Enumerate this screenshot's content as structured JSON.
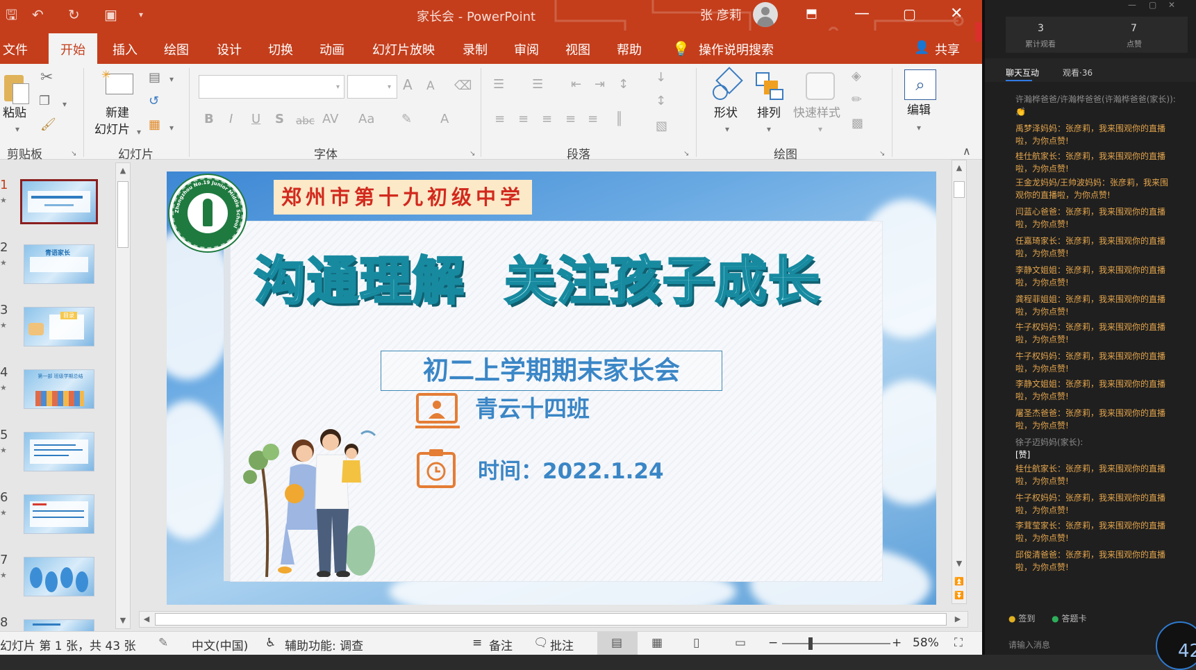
{
  "title_bar": {
    "document_title": "家长会 - PowerPoint",
    "user_name": "张 彦莉",
    "icons": [
      "save-icon",
      "undo-icon",
      "redo-icon",
      "present-from-start-icon",
      "customize-qat-icon",
      "ribbon-display-icon",
      "minimize-icon",
      "maximize-icon",
      "close-icon"
    ]
  },
  "menu": {
    "items": [
      "文件",
      "开始",
      "插入",
      "绘图",
      "设计",
      "切换",
      "动画",
      "幻灯片放映",
      "录制",
      "审阅",
      "视图",
      "帮助"
    ],
    "active": "开始",
    "tell_me": "操作说明搜索",
    "share": "共享"
  },
  "ribbon": {
    "groups": {
      "clipboard": "剪贴板",
      "slides": "幻灯片",
      "font": "字体",
      "paragraph": "段落",
      "drawing": "绘图"
    },
    "paste": "粘贴",
    "new_slide_1": "新建",
    "new_slide_2": "幻灯片",
    "shape": "形状",
    "arrange": "排列",
    "quick_styles": "快速样式",
    "edit": "编辑",
    "font_buttons": [
      "B",
      "I",
      "U",
      "S",
      "abc",
      "AV",
      "Aa",
      "A"
    ],
    "grow_font": "A",
    "shrink_font": "A"
  },
  "thumbnails": {
    "numbers": [
      "1",
      "2",
      "3",
      "4",
      "5",
      "6",
      "7",
      "8"
    ],
    "active_index": 0,
    "thumb2_title": "青语家长",
    "thumb3_title": "目录",
    "thumb4_title": "第一部 班级学期总结"
  },
  "slide": {
    "school_name": "郑州市第十九初级中学",
    "logo_text": "Zhengzhou No.19 Junior Middle School",
    "logo_cn": "郑州市第十九初级中学",
    "headline_left": "沟通理解",
    "headline_right": "关注孩子成长",
    "subtitle": "初二上学期期末家长会",
    "class_name": "青云十四班",
    "date_text": "时间：2022.1.24"
  },
  "status_bar": {
    "slide_info": "幻灯片 第 1 张，共 43 张",
    "language": "中文(中国)",
    "accessibility": "辅助功能: 调查",
    "notes": "备注",
    "comments": "批注",
    "zoom": "58%"
  },
  "live_panel": {
    "views_total": "3",
    "views_label": "累计观看",
    "likes": "7",
    "likes_label": "点赞",
    "tab_chat": "聊天互动",
    "tab_viewers": "观看·36",
    "messages": [
      {
        "text": "许瀚桦爸爸/许瀚桦爸爸(许瀚桦爸爸(家长)):",
        "gray": true,
        "extra": "👏"
      },
      {
        "text": "禹梦泽妈妈：张彦莉，我来围观你的直播啦，为你点赞!"
      },
      {
        "text": "桂仕航家长：张彦莉，我来围观你的直播啦，为你点赞!"
      },
      {
        "text": "王金龙妈妈/王帅波妈妈：张彦莉，我来围观你的直播啦，为你点赞!"
      },
      {
        "text": "闫蓝心爸爸：张彦莉，我来围观你的直播啦，为你点赞!"
      },
      {
        "text": "任嘉琦家长：张彦莉，我来围观你的直播啦，为你点赞!"
      },
      {
        "text": "李静文姐姐：张彦莉，我来围观你的直播啦，为你点赞!"
      },
      {
        "text": "龚程菲姐姐：张彦莉，我来围观你的直播啦，为你点赞!"
      },
      {
        "text": "牛子权妈妈：张彦莉，我来围观你的直播啦，为你点赞!"
      },
      {
        "text": "牛子权妈妈：张彦莉，我来围观你的直播啦，为你点赞!"
      },
      {
        "text": "李静文姐姐：张彦莉，我来围观你的直播啦，为你点赞!"
      },
      {
        "text": "屠圣杰爸爸：张彦莉，我来围观你的直播啦，为你点赞!"
      },
      {
        "text": "徐子迈妈妈(家长):",
        "gray": true,
        "extra": "[赞]"
      },
      {
        "text": "桂仕航家长：张彦莉，我来围观你的直播啦，为你点赞!"
      },
      {
        "text": "牛子权妈妈：张彦莉，我来围观你的直播啦，为你点赞!"
      },
      {
        "text": "李茸莹家长：张彦莉，我来围观你的直播啦，为你点赞!"
      },
      {
        "text": "邱俊清爸爸：张彦莉，我来围观你的直播啦，为你点赞!"
      }
    ],
    "sign_in": "签到",
    "answer_card": "答题卡",
    "input_placeholder": "请输入消息",
    "corner_number": "42"
  },
  "colors": {
    "accent": "#c43e1c",
    "headline_fill": "#9fe4ea",
    "headline_stroke": "#178aa0",
    "subtitle_blue": "#3a86c6",
    "chat_orange": "#e3a54d"
  }
}
